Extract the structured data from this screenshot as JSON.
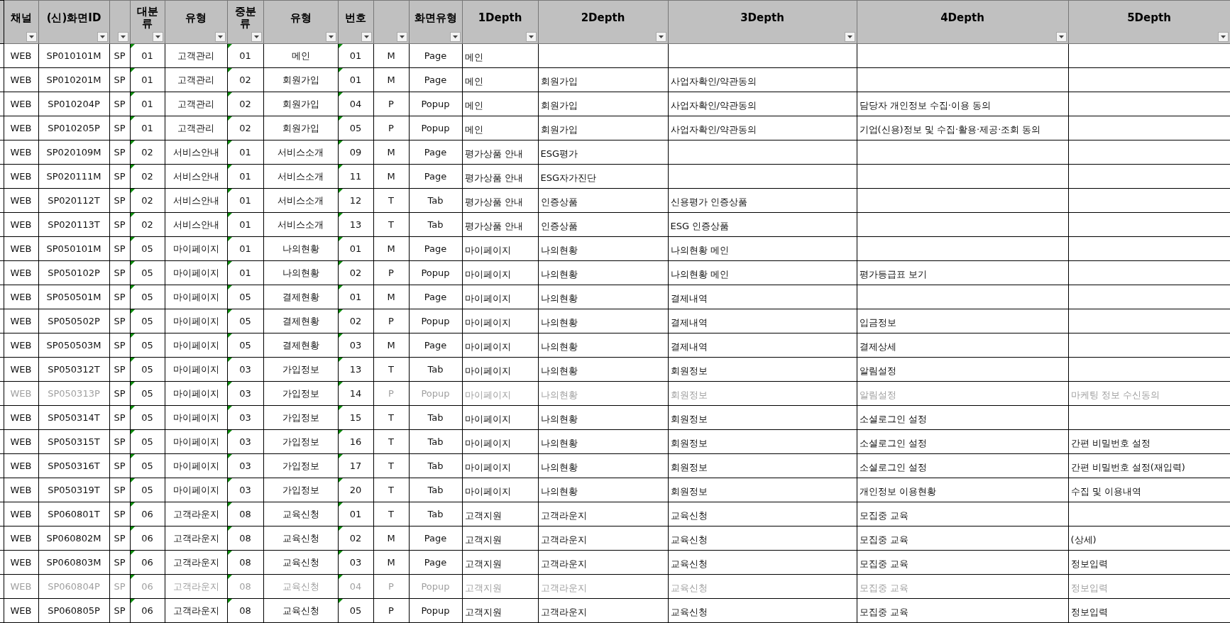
{
  "table": {
    "columns": [
      {
        "label": "채널",
        "kind": "code",
        "flagged": false
      },
      {
        "label": "(신)화면ID",
        "kind": "code",
        "flagged": false
      },
      {
        "kind": "code",
        "flagged": false
      },
      {
        "label": "대분류",
        "kind": "code",
        "flagged": true
      },
      {
        "label": "유형",
        "kind": "code",
        "flagged": false
      },
      {
        "label": "중분류",
        "kind": "code",
        "flagged": true
      },
      {
        "label": "유형",
        "kind": "code",
        "flagged": false
      },
      {
        "label": "번호",
        "kind": "code",
        "flagged": true
      },
      {
        "kind": "code",
        "flagged": false
      },
      {
        "label": "화면유형",
        "kind": "code",
        "flagged": false
      },
      {
        "label": "1Depth",
        "kind": "depth",
        "flagged": false
      },
      {
        "label": "2Depth",
        "kind": "depth",
        "flagged": false
      },
      {
        "label": "3Depth",
        "kind": "depth",
        "flagged": false
      },
      {
        "label": "4Depth",
        "kind": "depth",
        "flagged": false
      },
      {
        "label": "5Depth",
        "kind": "depth",
        "flagged": false
      }
    ],
    "rows": [
      {
        "cells": [
          "WEB",
          "SP010101M",
          "SP",
          "01",
          "고객관리",
          "01",
          "메인",
          "01",
          "M",
          "Page",
          "메인"
        ],
        "greyed": [
          false,
          false,
          false,
          false,
          false,
          false,
          false,
          false,
          false,
          false,
          false
        ]
      },
      {
        "cells": [
          "WEB",
          "SP010201M",
          "SP",
          "01",
          "고객관리",
          "02",
          "회원가입",
          "01",
          "M",
          "Page",
          "메인",
          "회원가입",
          "사업자확인/약관동의"
        ],
        "greyed": [
          false,
          false,
          false,
          false,
          false,
          false,
          false,
          false,
          false,
          false,
          false,
          false,
          false
        ]
      },
      {
        "cells": [
          "WEB",
          "SP010204P",
          "SP",
          "01",
          "고객관리",
          "02",
          "회원가입",
          "04",
          "P",
          "Popup",
          "메인",
          "회원가입",
          "사업자확인/약관동의",
          "담당자 개인정보 수집·이용 동의"
        ],
        "greyed": [
          false,
          false,
          false,
          false,
          false,
          false,
          false,
          false,
          false,
          false,
          false,
          false,
          false,
          false
        ]
      },
      {
        "cells": [
          "WEB",
          "SP010205P",
          "SP",
          "01",
          "고객관리",
          "02",
          "회원가입",
          "05",
          "P",
          "Popup",
          "메인",
          "회원가입",
          "사업자확인/약관동의",
          "기업(신용)정보 및 수집·활용·제공·조회 동의"
        ],
        "greyed": [
          false,
          false,
          false,
          false,
          false,
          false,
          false,
          false,
          false,
          false,
          false,
          false,
          false,
          false
        ]
      },
      {
        "cells": [
          "WEB",
          "SP020109M",
          "SP",
          "02",
          "서비스안내",
          "01",
          "서비스소개",
          "09",
          "M",
          "Page",
          "평가상품 안내",
          "ESG평가"
        ],
        "greyed": [
          false,
          false,
          false,
          false,
          false,
          false,
          false,
          false,
          false,
          false,
          false,
          false
        ]
      },
      {
        "cells": [
          "WEB",
          "SP020111M",
          "SP",
          "02",
          "서비스안내",
          "01",
          "서비스소개",
          "11",
          "M",
          "Page",
          "평가상품 안내",
          "ESG자가진단"
        ],
        "greyed": [
          false,
          false,
          false,
          false,
          false,
          false,
          false,
          false,
          false,
          false,
          false,
          false
        ]
      },
      {
        "cells": [
          "WEB",
          "SP020112T",
          "SP",
          "02",
          "서비스안내",
          "01",
          "서비스소개",
          "12",
          "T",
          "Tab",
          "평가상품 안내",
          "인증상품",
          "신용평가 인증상품"
        ],
        "greyed": [
          false,
          false,
          false,
          false,
          false,
          false,
          false,
          false,
          false,
          false,
          false,
          false,
          false
        ]
      },
      {
        "cells": [
          "WEB",
          "SP020113T",
          "SP",
          "02",
          "서비스안내",
          "01",
          "서비스소개",
          "13",
          "T",
          "Tab",
          "평가상품 안내",
          "인증상품",
          "ESG 인증상품"
        ],
        "greyed": [
          false,
          false,
          false,
          false,
          false,
          false,
          false,
          false,
          false,
          false,
          false,
          false,
          false
        ]
      },
      {
        "cells": [
          "WEB",
          "SP050101M",
          "SP",
          "05",
          "마이페이지",
          "01",
          "나의현황",
          "01",
          "M",
          "Page",
          "마이페이지",
          "나의현황",
          "나의현황 메인"
        ],
        "greyed": [
          false,
          false,
          false,
          false,
          false,
          false,
          false,
          false,
          false,
          false,
          false,
          false,
          false
        ]
      },
      {
        "cells": [
          "WEB",
          "SP050102P",
          "SP",
          "05",
          "마이페이지",
          "01",
          "나의현황",
          "02",
          "P",
          "Popup",
          "마이페이지",
          "나의현황",
          "나의현황 메인",
          "평가등급표 보기"
        ],
        "greyed": [
          false,
          false,
          false,
          false,
          false,
          false,
          false,
          false,
          false,
          false,
          false,
          false,
          false,
          false
        ]
      },
      {
        "cells": [
          "WEB",
          "SP050501M",
          "SP",
          "05",
          "마이페이지",
          "05",
          "결제현황",
          "01",
          "M",
          "Page",
          "마이페이지",
          "나의현황",
          "결제내역"
        ],
        "greyed": [
          false,
          false,
          false,
          false,
          false,
          false,
          false,
          false,
          false,
          false,
          false,
          false,
          false
        ]
      },
      {
        "cells": [
          "WEB",
          "SP050502P",
          "SP",
          "05",
          "마이페이지",
          "05",
          "결제현황",
          "02",
          "P",
          "Popup",
          "마이페이지",
          "나의현황",
          "결제내역",
          "입금정보"
        ],
        "greyed": [
          false,
          false,
          false,
          false,
          false,
          false,
          false,
          false,
          false,
          false,
          false,
          false,
          false,
          false
        ]
      },
      {
        "cells": [
          "WEB",
          "SP050503M",
          "SP",
          "05",
          "마이페이지",
          "05",
          "결제현황",
          "03",
          "M",
          "Page",
          "마이페이지",
          "나의현황",
          "결제내역",
          "결제상세"
        ],
        "greyed": [
          false,
          false,
          false,
          false,
          false,
          false,
          false,
          false,
          false,
          false,
          false,
          false,
          false,
          false
        ]
      },
      {
        "cells": [
          "WEB",
          "SP050312T",
          "SP",
          "05",
          "마이페이지",
          "03",
          "가입정보",
          "13",
          "T",
          "Tab",
          "마이페이지",
          "나의현황",
          "회원정보",
          "알림설정"
        ],
        "greyed": [
          false,
          false,
          false,
          false,
          false,
          false,
          false,
          false,
          false,
          false,
          false,
          false,
          false,
          false
        ]
      },
      {
        "cells": [
          "WEB",
          "SP050313P",
          "SP",
          "05",
          "마이페이지",
          "03",
          "가입정보",
          "14",
          "P",
          "Popup",
          "마이페이지",
          "나의현황",
          "회원정보",
          "알림설정",
          "마케팅 정보 수신동의"
        ],
        "greyed": [
          true,
          true,
          false,
          false,
          false,
          false,
          false,
          false,
          true,
          true,
          true,
          true,
          true,
          true,
          true
        ]
      },
      {
        "cells": [
          "WEB",
          "SP050314T",
          "SP",
          "05",
          "마이페이지",
          "03",
          "가입정보",
          "15",
          "T",
          "Tab",
          "마이페이지",
          "나의현황",
          "회원정보",
          "소셜로그인 설정"
        ],
        "greyed": [
          false,
          false,
          false,
          false,
          false,
          false,
          false,
          false,
          false,
          false,
          false,
          false,
          false,
          false
        ]
      },
      {
        "cells": [
          "WEB",
          "SP050315T",
          "SP",
          "05",
          "마이페이지",
          "03",
          "가입정보",
          "16",
          "T",
          "Tab",
          "마이페이지",
          "나의현황",
          "회원정보",
          "소셜로그인 설정",
          "간편 비밀번호 설정"
        ],
        "greyed": [
          false,
          false,
          false,
          false,
          false,
          false,
          false,
          false,
          false,
          false,
          false,
          false,
          false,
          false,
          false
        ]
      },
      {
        "cells": [
          "WEB",
          "SP050316T",
          "SP",
          "05",
          "마이페이지",
          "03",
          "가입정보",
          "17",
          "T",
          "Tab",
          "마이페이지",
          "나의현황",
          "회원정보",
          "소셜로그인 설정",
          "간편 비밀번호 설정(재입력)"
        ],
        "greyed": [
          false,
          false,
          false,
          false,
          false,
          false,
          false,
          false,
          false,
          false,
          false,
          false,
          false,
          false,
          false
        ]
      },
      {
        "cells": [
          "WEB",
          "SP050319T",
          "SP",
          "05",
          "마이페이지",
          "03",
          "가입정보",
          "20",
          "T",
          "Tab",
          "마이페이지",
          "나의현황",
          "회원정보",
          "개인정보 이용현황",
          "수집 및 이용내역"
        ],
        "greyed": [
          false,
          false,
          false,
          false,
          false,
          false,
          false,
          false,
          false,
          false,
          false,
          false,
          false,
          false,
          false
        ]
      },
      {
        "cells": [
          "WEB",
          "SP060801T",
          "SP",
          "06",
          "고객라운지",
          "08",
          "교육신청",
          "01",
          "T",
          "Tab",
          "고객지원",
          "고객라운지",
          "교육신청",
          "모집중 교육"
        ],
        "greyed": [
          false,
          false,
          false,
          false,
          false,
          false,
          false,
          false,
          false,
          false,
          false,
          false,
          false,
          false
        ]
      },
      {
        "cells": [
          "WEB",
          "SP060802M",
          "SP",
          "06",
          "고객라운지",
          "08",
          "교육신청",
          "02",
          "M",
          "Page",
          "고객지원",
          "고객라운지",
          "교육신청",
          "모집중 교육",
          "(상세)"
        ],
        "greyed": [
          false,
          false,
          false,
          false,
          false,
          false,
          false,
          false,
          false,
          false,
          false,
          false,
          false,
          false,
          false
        ]
      },
      {
        "cells": [
          "WEB",
          "SP060803M",
          "SP",
          "06",
          "고객라운지",
          "08",
          "교육신청",
          "03",
          "M",
          "Page",
          "고객지원",
          "고객라운지",
          "교육신청",
          "모집중 교육",
          "정보입력"
        ],
        "greyed": [
          false,
          false,
          false,
          false,
          false,
          false,
          false,
          false,
          false,
          false,
          false,
          false,
          false,
          false,
          false
        ]
      },
      {
        "cells": [
          "WEB",
          "SP060804P",
          "SP",
          "06",
          "고객라운지",
          "08",
          "교육신청",
          "04",
          "P",
          "Popup",
          "고객지원",
          "고객라운지",
          "교육신청",
          "모집중 교육",
          "정보입력"
        ],
        "greyed": [
          true,
          true,
          true,
          true,
          true,
          true,
          true,
          true,
          true,
          true,
          true,
          true,
          true,
          true,
          true
        ]
      },
      {
        "cells": [
          "WEB",
          "SP060805P",
          "SP",
          "06",
          "고객라운지",
          "08",
          "교육신청",
          "05",
          "P",
          "Popup",
          "고객지원",
          "고객라운지",
          "교육신청",
          "모집중 교육",
          "정보입력"
        ],
        "greyed": [
          false,
          false,
          false,
          false,
          false,
          false,
          false,
          false,
          false,
          false,
          false,
          false,
          false,
          false,
          false
        ]
      }
    ]
  }
}
